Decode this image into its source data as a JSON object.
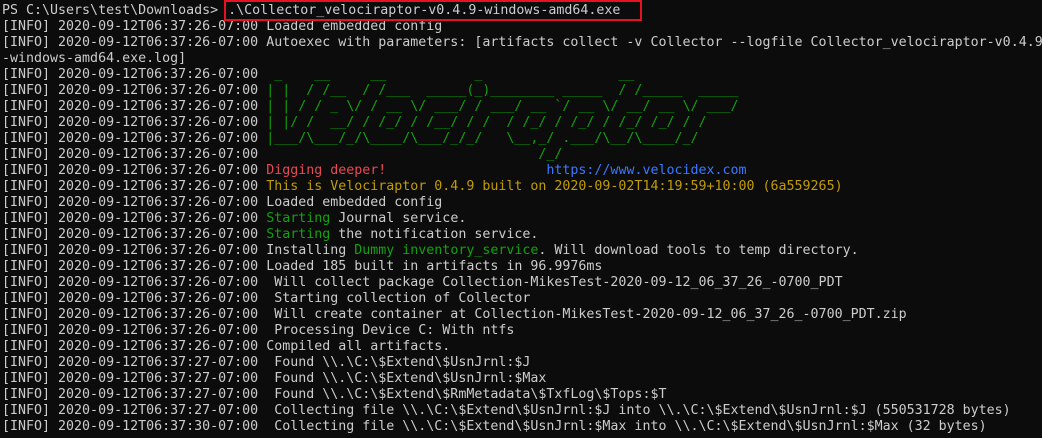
{
  "prompt": "PS C:\\Users\\test\\Downloads> ",
  "command": ".\\Collector_velociraptor-v0.4.9-windows-amd64.exe",
  "lines": [
    {
      "ts": "[INFO] 2020-09-12T06:37:26-07:00 ",
      "segments": [
        {
          "text": "Loaded embedded config",
          "color": "default"
        }
      ]
    },
    {
      "ts": "[INFO] 2020-09-12T06:37:26-07:00 ",
      "segments": [
        {
          "text": "Autoexec with parameters: [artifacts collect -v Collector --logfile Collector_velociraptor-v0.4.9",
          "color": "default"
        }
      ]
    },
    {
      "ts": "",
      "segments": [
        {
          "text": "-windows-amd64.exe.log]",
          "color": "default"
        }
      ]
    },
    {
      "ts": "[INFO] 2020-09-12T06:37:26-07:00 ",
      "segments": [
        {
          "text": " _    __     __           _                 __",
          "color": "green"
        }
      ]
    },
    {
      "ts": "[INFO] 2020-09-12T06:37:26-07:00 ",
      "segments": [
        {
          "text": "| |  / /__  / /___  _____(_)________ _____  / /_____  _____",
          "color": "green"
        }
      ]
    },
    {
      "ts": "[INFO] 2020-09-12T06:37:26-07:00 ",
      "segments": [
        {
          "text": "| | / / _ \\/ / __ \\/ ___/ / ___/ __ `/ __ \\/ __/ __ \\/ ___/",
          "color": "green"
        }
      ]
    },
    {
      "ts": "[INFO] 2020-09-12T06:37:26-07:00 ",
      "segments": [
        {
          "text": "| |/ /  __/ / /_/ / /__/ / /  / /_/ / /_/ / /_/ /_/ / /",
          "color": "green"
        }
      ]
    },
    {
      "ts": "[INFO] 2020-09-12T06:37:26-07:00 ",
      "segments": [
        {
          "text": "|___/\\___/_/\\____/\\___/_/_/   \\__,_/ .___/\\__/\\____/_/",
          "color": "green"
        }
      ]
    },
    {
      "ts": "[INFO] 2020-09-12T06:37:26-07:00 ",
      "segments": [
        {
          "text": "                                  /_/",
          "color": "green"
        }
      ]
    },
    {
      "ts": "[INFO] 2020-09-12T06:37:26-07:00 ",
      "segments": [
        {
          "text": "Digging deeper!",
          "color": "red"
        },
        {
          "text": "                    ",
          "color": "default"
        },
        {
          "text": "https://www.velocidex.com",
          "color": "blue"
        }
      ]
    },
    {
      "ts": "[INFO] 2020-09-12T06:37:26-07:00 ",
      "segments": [
        {
          "text": "This is Velociraptor 0.4.9 built on 2020-09-02T14:19:59+10:00 (6a559265)",
          "color": "yellow"
        }
      ]
    },
    {
      "ts": "[INFO] 2020-09-12T06:37:26-07:00 ",
      "segments": [
        {
          "text": "Loaded embedded config",
          "color": "default"
        }
      ]
    },
    {
      "ts": "[INFO] 2020-09-12T06:37:26-07:00 ",
      "segments": [
        {
          "text": "Starting",
          "color": "green"
        },
        {
          "text": " Journal service.",
          "color": "default"
        }
      ]
    },
    {
      "ts": "[INFO] 2020-09-12T06:37:26-07:00 ",
      "segments": [
        {
          "text": "Starting",
          "color": "green"
        },
        {
          "text": " the notification service.",
          "color": "default"
        }
      ]
    },
    {
      "ts": "[INFO] 2020-09-12T06:37:26-07:00 ",
      "segments": [
        {
          "text": "Installing ",
          "color": "default"
        },
        {
          "text": "Dummy inventory_service",
          "color": "green"
        },
        {
          "text": ". Will download tools to temp directory.",
          "color": "default"
        }
      ]
    },
    {
      "ts": "[INFO] 2020-09-12T06:37:26-07:00 ",
      "segments": [
        {
          "text": "Loaded 185 built in artifacts in 96.9976ms",
          "color": "default"
        }
      ]
    },
    {
      "ts": "[INFO] 2020-09-12T06:37:26-07:00 ",
      "segments": [
        {
          "text": " Will collect package Collection-MikesTest-2020-09-12_06_37_26_-0700_PDT",
          "color": "default"
        }
      ]
    },
    {
      "ts": "[INFO] 2020-09-12T06:37:26-07:00 ",
      "segments": [
        {
          "text": " Starting collection of Collector",
          "color": "default"
        }
      ]
    },
    {
      "ts": "[INFO] 2020-09-12T06:37:26-07:00 ",
      "segments": [
        {
          "text": " Will create container at Collection-MikesTest-2020-09-12_06_37_26_-0700_PDT.zip",
          "color": "default"
        }
      ]
    },
    {
      "ts": "[INFO] 2020-09-12T06:37:26-07:00 ",
      "segments": [
        {
          "text": " Processing Device C: With ntfs",
          "color": "default"
        }
      ]
    },
    {
      "ts": "[INFO] 2020-09-12T06:37:26-07:00 ",
      "segments": [
        {
          "text": "Compiled all artifacts.",
          "color": "default"
        }
      ]
    },
    {
      "ts": "[INFO] 2020-09-12T06:37:27-07:00 ",
      "segments": [
        {
          "text": " Found \\\\.\\C:\\$Extend\\$UsnJrnl:$J",
          "color": "default"
        }
      ]
    },
    {
      "ts": "[INFO] 2020-09-12T06:37:27-07:00 ",
      "segments": [
        {
          "text": " Found \\\\.\\C:\\$Extend\\$UsnJrnl:$Max",
          "color": "default"
        }
      ]
    },
    {
      "ts": "[INFO] 2020-09-12T06:37:27-07:00 ",
      "segments": [
        {
          "text": " Found \\\\.\\C:\\$Extend\\$RmMetadata\\$TxfLog\\$Tops:$T",
          "color": "default"
        }
      ]
    },
    {
      "ts": "[INFO] 2020-09-12T06:37:27-07:00 ",
      "segments": [
        {
          "text": " Collecting file \\\\.\\C:\\$Extend\\$UsnJrnl:$J into \\\\.\\C:\\$Extend\\$UsnJrnl:$J (550531728 bytes)",
          "color": "default"
        }
      ]
    },
    {
      "ts": "[INFO] 2020-09-12T06:37:30-07:00 ",
      "segments": [
        {
          "text": " Collecting file \\\\.\\C:\\$Extend\\$UsnJrnl:$Max into \\\\.\\C:\\$Extend\\$UsnJrnl:$Max (32 bytes)",
          "color": "default"
        }
      ]
    }
  ]
}
